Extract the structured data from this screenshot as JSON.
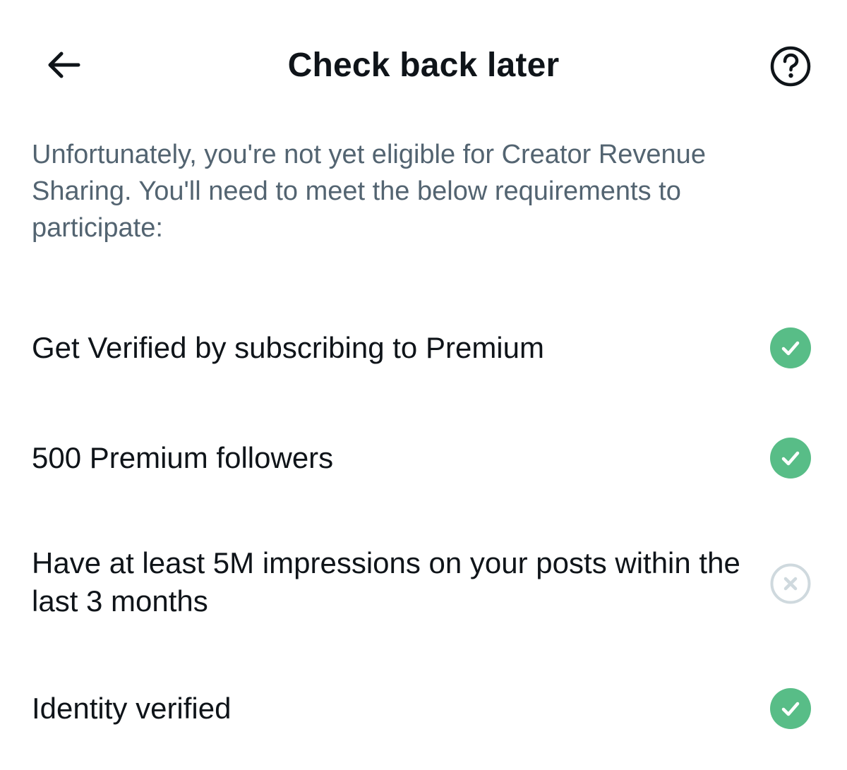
{
  "header": {
    "title": "Check back later",
    "back_icon": "arrow-left-icon",
    "help_icon": "question-circle-icon"
  },
  "intro_text": "Unfortunately, you're not yet eligible for Creator Revenue Sharing. You'll need to meet the below requirements to participate:",
  "requirements": [
    {
      "label": "Get Verified by subscribing to Premium",
      "status": "met",
      "icon": "check-circle-icon"
    },
    {
      "label": "500 Premium followers",
      "status": "met",
      "icon": "check-circle-icon"
    },
    {
      "label": "Have at least 5M impressions on your posts within the last 3 months",
      "status": "not-met",
      "icon": "x-circle-icon"
    },
    {
      "label": "Identity verified",
      "status": "met",
      "icon": "check-circle-icon"
    }
  ],
  "colors": {
    "met": "#58bd87",
    "not_met": "#cfd9de",
    "text_primary": "#0f1419",
    "text_secondary": "#536471"
  }
}
